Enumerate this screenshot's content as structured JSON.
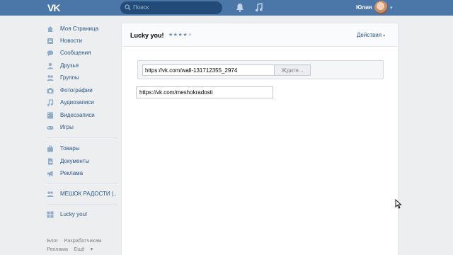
{
  "topbar": {
    "logo": "VK",
    "search_placeholder": "Поиск",
    "user_name": "Юлия"
  },
  "sidebar": {
    "items": [
      {
        "label": "Моя Страница",
        "icon": "home-icon"
      },
      {
        "label": "Новости",
        "icon": "news-icon"
      },
      {
        "label": "Сообщения",
        "icon": "messages-icon"
      },
      {
        "label": "Друзья",
        "icon": "friends-icon"
      },
      {
        "label": "Группы",
        "icon": "groups-icon"
      },
      {
        "label": "Фотографии",
        "icon": "camera-icon"
      },
      {
        "label": "Аудиозаписи",
        "icon": "music-icon"
      },
      {
        "label": "Видеозаписи",
        "icon": "film-icon"
      },
      {
        "label": "Игры",
        "icon": "gamepad-icon"
      },
      {
        "label": "Товары",
        "icon": "bag-icon"
      },
      {
        "label": "Документы",
        "icon": "document-icon"
      },
      {
        "label": "Реклама",
        "icon": "megaphone-icon"
      },
      {
        "label": "МЕШОК РАДОСТИ |..",
        "icon": "group-people-icon"
      },
      {
        "label": "Lucky you!",
        "icon": "app-grid-icon"
      }
    ],
    "footer": [
      "Блог",
      "Разработчикам",
      "Реклама",
      "Ещё"
    ]
  },
  "app": {
    "title": "Lucky you!",
    "rating_text": "★★★★★",
    "rating": 4,
    "actions_label": "Действия"
  },
  "form": {
    "wall_url": "https://vk.com/wall-131712355_2974",
    "wait_label": "Ждите...",
    "group_url": "https://vk.com/meshokradosti"
  },
  "colors": {
    "header": "#4a76a8",
    "link": "#2a5885",
    "background": "#edeef0"
  }
}
